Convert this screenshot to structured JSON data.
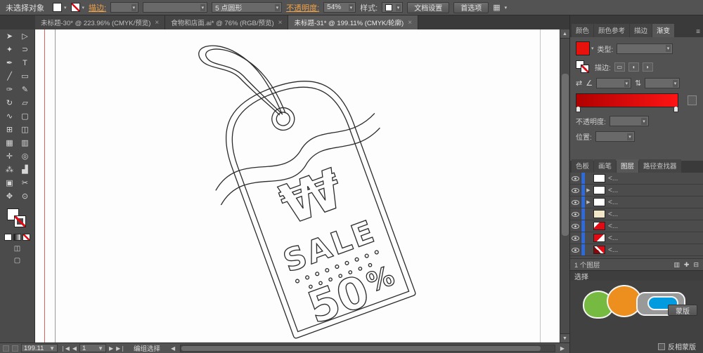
{
  "topbar": {
    "status": "未选择对象",
    "stroke_label": "描边:",
    "brush_label": "5 点圆形",
    "opacity_label": "不透明度:",
    "opacity_value": "54%",
    "style_label": "样式:",
    "doc_setup_button": "文档设置",
    "preferences_button": "首选项"
  },
  "tabs": [
    {
      "label": "未标题-30* @ 223.96% (CMYK/预览)",
      "close": "×"
    },
    {
      "label": "食物和店面.ai* @ 76% (RGB/预览)",
      "close": "×"
    },
    {
      "label": "未标题-31* @ 199.11% (CMYK/轮廓)",
      "close": "×"
    }
  ],
  "toolbar": {
    "tools": [
      {
        "name": "selection-tool",
        "glyph": "➤"
      },
      {
        "name": "direct-selection-tool",
        "glyph": "▷"
      },
      {
        "name": "magic-wand-tool",
        "glyph": "✦"
      },
      {
        "name": "lasso-tool",
        "glyph": "⊃"
      },
      {
        "name": "pen-tool",
        "glyph": "✒"
      },
      {
        "name": "type-tool",
        "glyph": "T"
      },
      {
        "name": "line-segment-tool",
        "glyph": "╱"
      },
      {
        "name": "rectangle-tool",
        "glyph": "▭"
      },
      {
        "name": "paintbrush-tool",
        "glyph": "✑"
      },
      {
        "name": "pencil-tool",
        "glyph": "✎"
      },
      {
        "name": "rotate-tool",
        "glyph": "↻"
      },
      {
        "name": "scale-tool",
        "glyph": "▱"
      },
      {
        "name": "width-tool",
        "glyph": "∿"
      },
      {
        "name": "free-transform-tool",
        "glyph": "▢"
      },
      {
        "name": "shape-builder-tool",
        "glyph": "⊞"
      },
      {
        "name": "perspective-grid-tool",
        "glyph": "◫"
      },
      {
        "name": "mesh-tool",
        "glyph": "▦"
      },
      {
        "name": "gradient-tool",
        "glyph": "▥"
      },
      {
        "name": "eyedropper-tool",
        "glyph": "✛"
      },
      {
        "name": "blend-tool",
        "glyph": "◎"
      },
      {
        "name": "symbol-sprayer-tool",
        "glyph": "⁂"
      },
      {
        "name": "column-graph-tool",
        "glyph": "▟"
      },
      {
        "name": "artboard-tool",
        "glyph": "▣"
      },
      {
        "name": "slice-tool",
        "glyph": "✂"
      },
      {
        "name": "hand-tool",
        "glyph": "✥"
      },
      {
        "name": "zoom-tool",
        "glyph": "⊙"
      }
    ]
  },
  "canvas": {
    "tag": {
      "currency": "₩",
      "sale": "SALE",
      "percent_number": "50",
      "percent_sign": "%"
    }
  },
  "right_panel": {
    "color_tabs": [
      "颜色",
      "颜色参考",
      "描边",
      "渐变"
    ],
    "panel_menu_icon": "≡",
    "gradient": {
      "type_label": "类型:",
      "stroke_label": "描边:",
      "opacity_label": "不透明度:",
      "location_label": "位置:",
      "swatch_color": "#e8120c",
      "gradient_start": "#b00000",
      "gradient_end": "#ff1414"
    },
    "panel_tabs": [
      "色板",
      "画笔",
      "图层",
      "路径查找器"
    ],
    "layers": {
      "rows": [
        {
          "label": "<...",
          "thumb": "white",
          "expandable": false
        },
        {
          "label": "<...",
          "thumb": "white",
          "expandable": true
        },
        {
          "label": "<...",
          "thumb": "white",
          "expandable": true
        },
        {
          "label": "<...",
          "thumb": "beige",
          "expandable": false
        },
        {
          "label": "<...",
          "thumb": "red1",
          "expandable": false
        },
        {
          "label": "<...",
          "thumb": "red2",
          "expandable": false
        },
        {
          "label": "<...",
          "thumb": "red3",
          "expandable": false
        }
      ],
      "count_text": "1 个图层"
    },
    "transparency": {
      "header": "选择",
      "mask_button": "蒙版",
      "invert_label": "反相蒙版"
    },
    "selection_color": "#2e6bd8"
  },
  "statusbar": {
    "zoom": "199.11",
    "artboard": "1",
    "status": "编组选择"
  }
}
